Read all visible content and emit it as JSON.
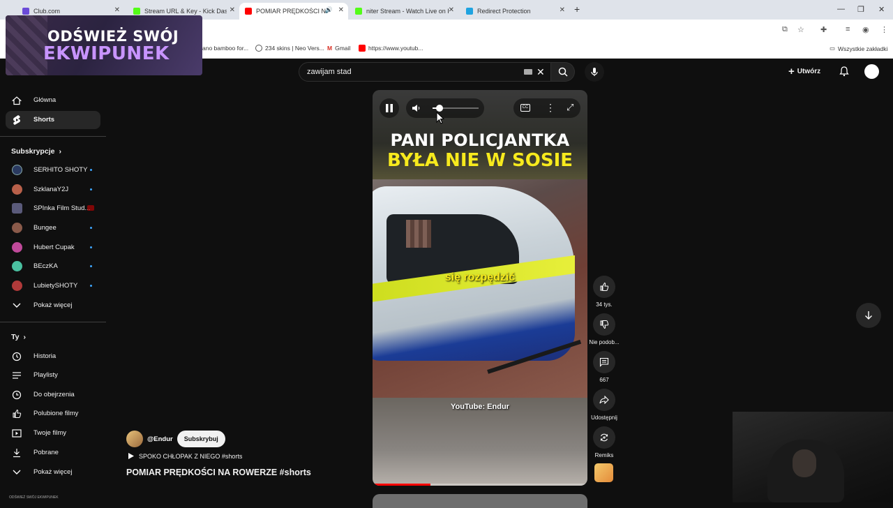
{
  "browser": {
    "tabs": [
      {
        "title": "Club.com",
        "color": "#6b4bd8"
      },
      {
        "title": "Stream URL & Key - Kick Dashb",
        "color": "#53fc18"
      },
      {
        "title": "POMIAR PRĘDKOŚCI NA R",
        "color": "#ff0000"
      },
      {
        "title": "niter Stream - Watch Live on Ki",
        "color": "#53fc18"
      },
      {
        "title": "Redirect Protection",
        "color": "#1fa3e0"
      }
    ],
    "bookmarks": [
      {
        "label": "ano bamboo for..."
      },
      {
        "label": "234 skins | Neo Vers..."
      },
      {
        "label": "Gmail"
      },
      {
        "label": "https://www.youtub..."
      }
    ],
    "all_bookmarks": "Wszystkie zakładki"
  },
  "promo": {
    "line1": "ODŚWIEŻ SWÓJ",
    "line2": "EKWIPUNEK"
  },
  "search": {
    "query": "zawijam stad"
  },
  "header": {
    "create_label": "Utwórz"
  },
  "sidebar": {
    "main": [
      {
        "label": "Główna",
        "icon": "home-icon"
      },
      {
        "label": "Shorts",
        "icon": "shorts-icon"
      }
    ],
    "subs_title": "Subskrypcje",
    "subscriptions": [
      {
        "label": "SERHITO SHOTY",
        "color": "#2a3a60"
      },
      {
        "label": "SzklanaY2J",
        "color": "#b8604a"
      },
      {
        "label": "SPInka Film Stud...",
        "color": "#5a5a7a"
      },
      {
        "label": "Bungee",
        "color": "#8a5a4a"
      },
      {
        "label": "Hubert Cupak",
        "color": "#c04a9a"
      },
      {
        "label": "BEczKA",
        "color": "#4ac0a0"
      },
      {
        "label": "LubietySHOTY",
        "color": "#b03a3a"
      }
    ],
    "show_more": "Pokaż więcej",
    "you_title": "Ty",
    "you_items": [
      {
        "label": "Historia"
      },
      {
        "label": "Playlisty"
      },
      {
        "label": "Do obejrzenia"
      },
      {
        "label": "Polubione filmy"
      },
      {
        "label": "Twoje filmy"
      },
      {
        "label": "Pobrane"
      },
      {
        "label": "Pokaż więcej"
      }
    ],
    "footer_text": "ODŚWIEŻ SWÓJ EKWIPUNEK"
  },
  "video": {
    "headline1": "PANI POLICJANTKA",
    "headline2": "BYŁA NIE W SOSIE",
    "caption": "się rozpędzić",
    "watermark": "YouTube: Endur",
    "volume_fraction": 0.15,
    "progress_fraction": 0.27
  },
  "actions": {
    "like_count": "34 tys.",
    "dislike_label": "Nie podob...",
    "comments_count": "667",
    "share_label": "Udostępnij",
    "remix_label": "Remiks"
  },
  "channel": {
    "handle": "@Endur",
    "subscribe_label": "Subskrybuj",
    "playlist_line": "SPOKO CHŁOPAK Z NIEGO #shorts",
    "title": "POMIAR PRĘDKOŚCI NA ROWERZE #shorts"
  }
}
